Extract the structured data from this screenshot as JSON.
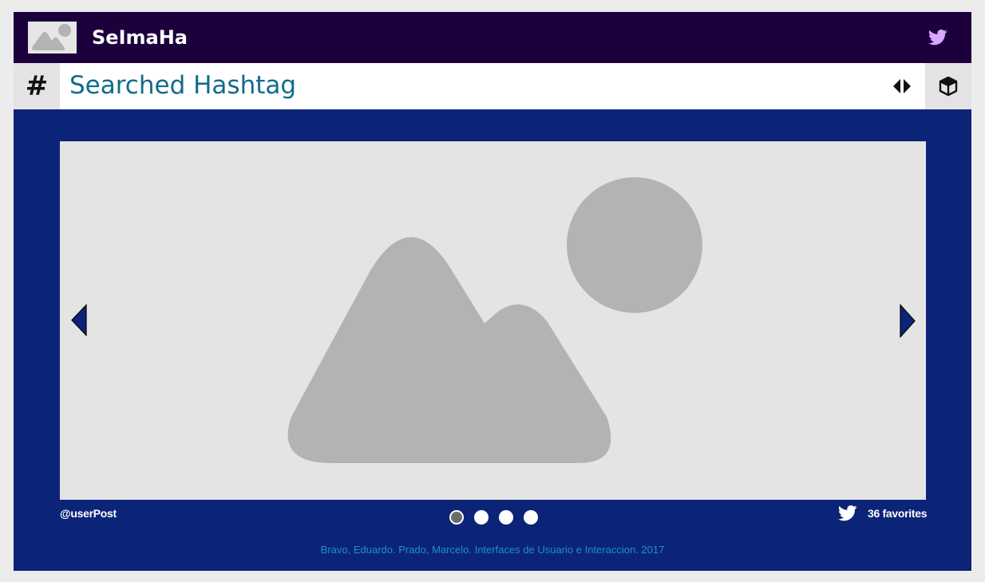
{
  "header": {
    "brand": "SeImaHa",
    "logo_icon": "image-placeholder-icon",
    "twitter_icon": "twitter-bird-icon"
  },
  "search": {
    "hash_symbol": "#",
    "hashtag": "Searched Hashtag",
    "toggle_icon": "left-right-arrows-icon",
    "cube_icon": "cube-icon"
  },
  "carousel": {
    "image_icon": "image-placeholder-icon",
    "slides_count": 4,
    "active_slide": 1
  },
  "post": {
    "user": "@userPost",
    "favorites": "36 favorites"
  },
  "footer": {
    "credits": "Bravo, Eduardo. Prado, Marcelo. Interfaces de Usuario e Interaccion. 2017"
  },
  "colors": {
    "page_bg": "#ececec",
    "topbar": "#1c003c",
    "main_bg": "#0c2477",
    "hashtag_text": "#116b8b",
    "footer_text": "#1a8fd0",
    "twitter_top": "#d9a7ff"
  }
}
